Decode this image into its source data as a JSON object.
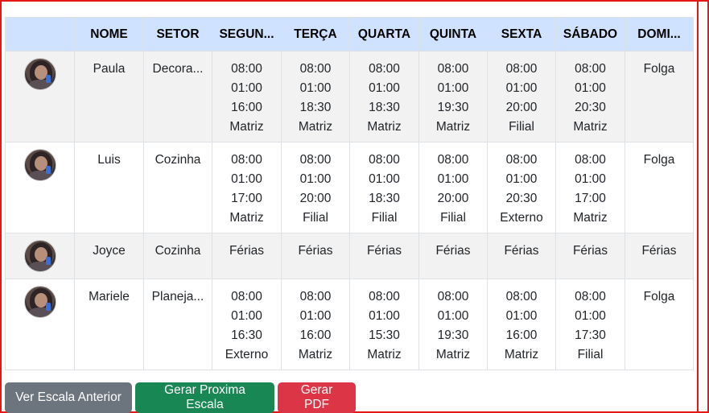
{
  "headers": [
    "",
    "NOME",
    "SETOR",
    "SEGUN...",
    "TERÇA",
    "QUARTA",
    "QUINTA",
    "SEXTA",
    "SÁBADO",
    "DOMI..."
  ],
  "rows": [
    {
      "nome": "Paula",
      "setor": "Decora...",
      "days": [
        [
          "08:00",
          "01:00",
          "16:00",
          "Matriz"
        ],
        [
          "08:00",
          "01:00",
          "18:30",
          "Matriz"
        ],
        [
          "08:00",
          "01:00",
          "18:30",
          "Matriz"
        ],
        [
          "08:00",
          "01:00",
          "19:30",
          "Matriz"
        ],
        [
          "08:00",
          "01:00",
          "20:00",
          "Filial"
        ],
        [
          "08:00",
          "01:00",
          "20:30",
          "Matriz"
        ],
        [
          "Folga"
        ]
      ]
    },
    {
      "nome": "Luis",
      "setor": "Cozinha",
      "days": [
        [
          "08:00",
          "01:00",
          "17:00",
          "Matriz"
        ],
        [
          "08:00",
          "01:00",
          "20:00",
          "Filial"
        ],
        [
          "08:00",
          "01:00",
          "18:30",
          "Filial"
        ],
        [
          "08:00",
          "01:00",
          "20:00",
          "Filial"
        ],
        [
          "08:00",
          "01:00",
          "20:30",
          "Externo"
        ],
        [
          "08:00",
          "01:00",
          "17:00",
          "Matriz"
        ],
        [
          "Folga"
        ]
      ]
    },
    {
      "nome": "Joyce",
      "setor": "Cozinha",
      "days": [
        [
          "Férias"
        ],
        [
          "Férias"
        ],
        [
          "Férias"
        ],
        [
          "Férias"
        ],
        [
          "Férias"
        ],
        [
          "Férias"
        ],
        [
          "Férias"
        ]
      ]
    },
    {
      "nome": "Mariele",
      "setor": "Planeja...",
      "days": [
        [
          "08:00",
          "01:00",
          "16:30",
          "Externo"
        ],
        [
          "08:00",
          "01:00",
          "16:00",
          "Matriz"
        ],
        [
          "08:00",
          "01:00",
          "15:30",
          "Matriz"
        ],
        [
          "08:00",
          "01:00",
          "19:30",
          "Matriz"
        ],
        [
          "08:00",
          "01:00",
          "16:00",
          "Matriz"
        ],
        [
          "08:00",
          "01:00",
          "17:30",
          "Filial"
        ],
        [
          "Folga"
        ]
      ]
    }
  ],
  "buttons": {
    "previous": "Ver Escala Anterior",
    "next": "Gerar Proxima Escala",
    "pdf": "Gerar PDF"
  },
  "colors": {
    "header_bg": "#cfe2ff",
    "stripe_bg": "#f2f2f2",
    "border_red": "#e81717",
    "btn_secondary": "#6c757d",
    "btn_success": "#198754",
    "btn_danger": "#dc3545"
  }
}
